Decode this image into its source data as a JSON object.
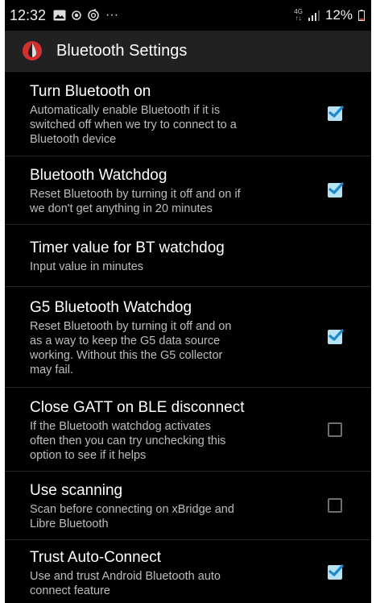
{
  "status_bar": {
    "time": "12:32",
    "overflow": "···",
    "network_top": "4G",
    "network_bottom": "↑↓",
    "battery": "12%"
  },
  "action_bar": {
    "title": "Bluetooth Settings",
    "icon": "xdrip-drop-icon",
    "icon_color": "#d32f2f"
  },
  "preferences": [
    {
      "title": "Turn Bluetooth on",
      "summary": "Automatically enable Bluetooth if it is\nswitched off when we try to connect to a\nBluetooth device",
      "checked": true
    },
    {
      "title": "Bluetooth Watchdog",
      "summary": "Reset Bluetooth by turning it off and on if\nwe don't get anything in 20 minutes",
      "checked": true
    },
    {
      "title": "Timer value for BT watchdog",
      "summary": "Input value in minutes",
      "checked": null
    },
    {
      "title": "G5 Bluetooth Watchdog",
      "summary": "Reset Bluetooth by turning it off and on\nas a way to keep the G5 data source\nworking. Without this the G5 collector\nmay fail.",
      "checked": true
    },
    {
      "title": "Close GATT on BLE disconnect",
      "summary": "If the Bluetooth watchdog activates\noften then you can try unchecking this\noption to see if it helps",
      "checked": false
    },
    {
      "title": "Use scanning",
      "summary": "Scan before connecting on xBridge and\nLibre Bluetooth",
      "checked": false
    },
    {
      "title": "Trust Auto-Connect",
      "summary": "Use and trust Android Bluetooth auto\nconnect feature",
      "checked": true
    }
  ],
  "colors": {
    "background": "#000000",
    "action_bar": "#212121",
    "checkbox_checked": "#b7e2f3",
    "checkmark": "#1e88c8"
  }
}
